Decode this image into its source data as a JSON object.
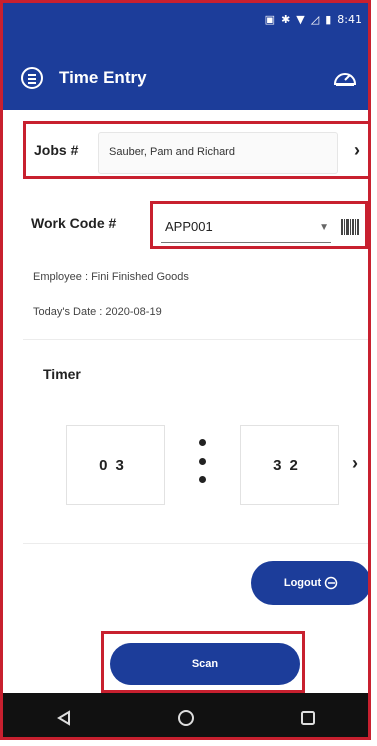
{
  "status_bar": {
    "time": "8:41"
  },
  "app_bar": {
    "title": "Time Entry",
    "menu_icon": "hamburger-circle-icon",
    "gauge_icon": "dashboard-gauge-icon"
  },
  "jobs": {
    "label": "Jobs #",
    "value": "Sauber, Pam and Richard"
  },
  "work_code": {
    "label": "Work Code #",
    "value": "APP001"
  },
  "employee_text": "Employee : Fini Finished Goods",
  "date_text": "Today's Date : 2020-08-19",
  "timer": {
    "label": "Timer",
    "left_digits": "03",
    "right_digits": "32"
  },
  "logout_button": "Logout",
  "scan_button": "Scan",
  "colors": {
    "primary": "#1c3d9a",
    "highlight": "#c8202f",
    "navbar": "#111111"
  }
}
